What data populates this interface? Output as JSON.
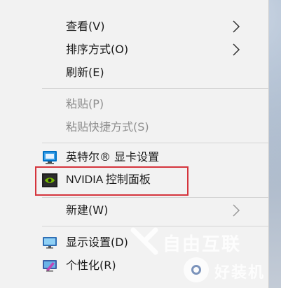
{
  "menu": {
    "items": [
      {
        "label": "查看(V)"
      },
      {
        "label": "排序方式(O)"
      },
      {
        "label": "刷新(E)"
      },
      {
        "label": "粘贴(P)"
      },
      {
        "label": "粘贴快捷方式(S)"
      },
      {
        "label": "英特尔® 显卡设置"
      },
      {
        "label": "NVIDIA 控制面板"
      },
      {
        "label": "新建(W)"
      },
      {
        "label": "显示设置(D)"
      },
      {
        "label": "个性化(R)"
      }
    ]
  },
  "watermarks": {
    "brand_top": "自由互联",
    "brand_bottom": "好装机"
  },
  "colors": {
    "menu_bg": "#f2f2f2",
    "highlight_border": "#d5343c",
    "nvidia_green": "#76b900",
    "intel_blue": "#0071c5"
  }
}
